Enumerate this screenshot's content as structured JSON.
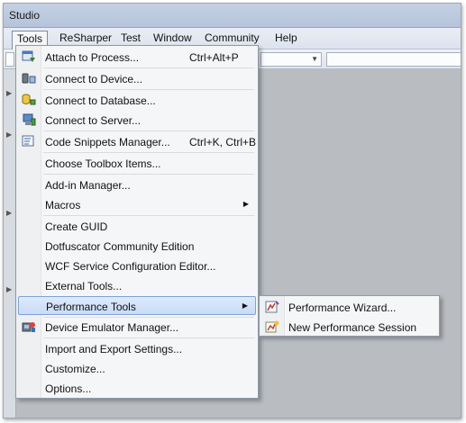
{
  "window": {
    "title": "Studio"
  },
  "menubar": {
    "items": [
      {
        "label": "Tools",
        "active": true
      },
      {
        "label": "ReSharper"
      },
      {
        "label": "Test"
      },
      {
        "label": "Window"
      },
      {
        "label": "Community"
      },
      {
        "label": "Help"
      }
    ]
  },
  "tools_menu": {
    "items": [
      {
        "label": "Attach to Process...",
        "shortcut": "Ctrl+Alt+P",
        "icon": "attach-process-icon"
      },
      {
        "label": "Connect to Device...",
        "icon": "connect-device-icon"
      },
      {
        "label": "Connect to Database...",
        "icon": "connect-database-icon"
      },
      {
        "label": "Connect to Server...",
        "icon": "connect-server-icon"
      },
      {
        "label": "Code Snippets Manager...",
        "shortcut": "Ctrl+K, Ctrl+B",
        "icon": "code-snippets-icon"
      },
      {
        "label": "Choose Toolbox Items..."
      },
      {
        "label": "Add-in Manager..."
      },
      {
        "label": "Macros",
        "submenu": true
      },
      {
        "label": "Create GUID"
      },
      {
        "label": "Dotfuscator Community Edition"
      },
      {
        "label": "WCF Service Configuration Editor..."
      },
      {
        "label": "External Tools..."
      },
      {
        "label": "Performance Tools",
        "submenu": true,
        "highlighted": true
      },
      {
        "label": "Device Emulator Manager...",
        "icon": "device-emulator-icon"
      },
      {
        "label": "Import and Export Settings..."
      },
      {
        "label": "Customize..."
      },
      {
        "label": "Options..."
      }
    ],
    "submenu_arrow": "▶"
  },
  "performance_submenu": {
    "items": [
      {
        "label": "Performance Wizard...",
        "icon": "performance-wizard-icon"
      },
      {
        "label": "New Performance Session",
        "icon": "new-performance-session-icon"
      }
    ]
  },
  "colors": {
    "highlight": "#c8dbf6",
    "highlight_border": "#7ea2d8",
    "workspace": "#b9bcc1"
  }
}
